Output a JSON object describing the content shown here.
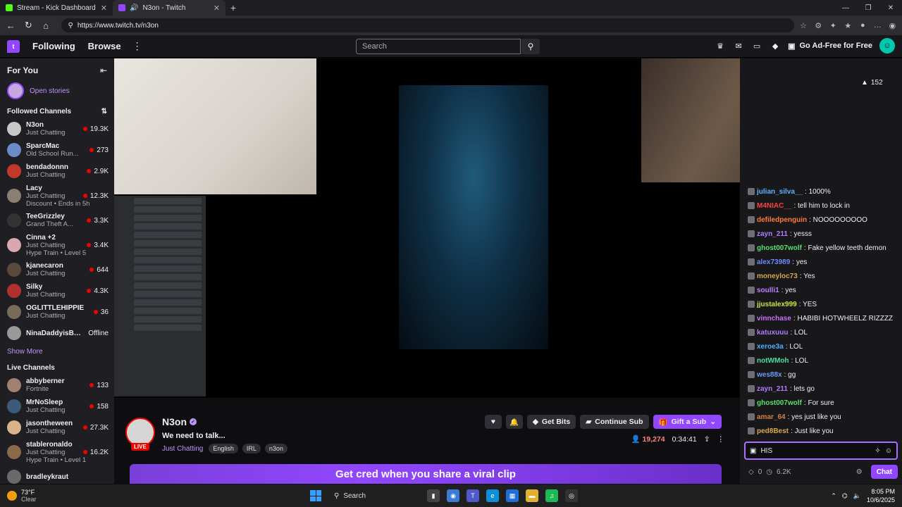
{
  "browser": {
    "tabs": [
      {
        "title": "Stream - Kick Dashboard",
        "active": false,
        "color": "#53fc18"
      },
      {
        "title": "N3on - Twitch",
        "active": true,
        "color": "#9147ff"
      }
    ],
    "url": "https://www.twitch.tv/n3on"
  },
  "topnav": {
    "following": "Following",
    "browse": "Browse",
    "search_placeholder": "Search",
    "ad_free": "Go Ad-Free for Free"
  },
  "sidebar": {
    "for_you": "For You",
    "open_stories": "Open stories",
    "followed_title": "Followed Channels",
    "followed": [
      {
        "name": "N3on",
        "game": "Just Chatting",
        "viewers": "19.3K",
        "extra": "",
        "color": "#c7c7c7"
      },
      {
        "name": "SparcMac",
        "game": "Old School Run...",
        "viewers": "273",
        "extra": "",
        "color": "#6b8cc7"
      },
      {
        "name": "bendadonnn",
        "game": "Just Chatting",
        "viewers": "2.9K",
        "extra": "",
        "color": "#c0392b"
      },
      {
        "name": "Lacy",
        "game": "Just Chatting",
        "viewers": "12.3K",
        "extra": "Discount • Ends in 5h",
        "color": "#8a7f72"
      },
      {
        "name": "TeeGrizzley",
        "game": "Grand Theft A...",
        "viewers": "3.3K",
        "extra": "",
        "color": "#333333"
      },
      {
        "name": "Cinna +2",
        "game": "Just Chatting",
        "viewers": "3.4K",
        "extra": "Hype Train • Level 5",
        "color": "#d9a7b0"
      },
      {
        "name": "kjanecaron",
        "game": "Just Chatting",
        "viewers": "644",
        "extra": "",
        "color": "#5a4a3a"
      },
      {
        "name": "Silky",
        "game": "Just Chatting",
        "viewers": "4.3K",
        "extra": "",
        "color": "#b03030"
      },
      {
        "name": "OGLITTLEHIPPIE",
        "game": "Just Chatting",
        "viewers": "36",
        "extra": "",
        "color": "#7a6a5a"
      },
      {
        "name": "NinaDaddyisBa...",
        "game": "",
        "viewers": "Offline",
        "extra": "",
        "color": "#999999"
      }
    ],
    "show_more": "Show More",
    "live_title": "Live Channels",
    "live": [
      {
        "name": "abbyberner",
        "game": "Fortnite",
        "viewers": "133",
        "extra": "",
        "color": "#a08070"
      },
      {
        "name": "MrNoSleep",
        "game": "Just Chatting",
        "viewers": "158",
        "extra": "",
        "color": "#3c5a7a"
      },
      {
        "name": "jasontheween",
        "game": "Just Chatting",
        "viewers": "27.3K",
        "extra": "",
        "color": "#d8b48a"
      },
      {
        "name": "stableronaldo",
        "game": "Just Chatting",
        "viewers": "16.2K",
        "extra": "Hype Train • Level 1",
        "color": "#8a6a4a"
      },
      {
        "name": "bradleykraut",
        "game": "",
        "viewers": "",
        "extra": "",
        "color": "#6a6a6a"
      }
    ]
  },
  "stream": {
    "name": "N3on",
    "live": "LIVE",
    "title": "We need to talk...",
    "category": "Just Chatting",
    "tags": [
      "English",
      "IRL",
      "n3on"
    ],
    "get_bits": "Get Bits",
    "continue_sub": "Continue Sub",
    "gift_sub": "Gift a Sub",
    "viewers": "19,274",
    "uptime": "0:34:41"
  },
  "banner": "Get cred when you share a viral clip",
  "chat": {
    "viewer_count_side": "152",
    "messages": [
      {
        "user": "julian_silva__",
        "text": ": 1000%",
        "color": "#5fb3ff"
      },
      {
        "user": "M4NIAC__",
        "text": ": tell him to lock in",
        "color": "#ff4040"
      },
      {
        "user": "defiledpenguin",
        "text": ": NOOOOOOOOO",
        "color": "#ff7a3a"
      },
      {
        "user": "zayn_211",
        "text": ": yesss",
        "color": "#b47aff"
      },
      {
        "user": "ghost007wolf",
        "text": ": Fake yellow teeth demon",
        "color": "#57e06b"
      },
      {
        "user": "alex73989",
        "text": ": yes",
        "color": "#6a8cff"
      },
      {
        "user": "moneyloc73",
        "text": ": Yes",
        "color": "#d4a84a"
      },
      {
        "user": "soulli1",
        "text": ": yes",
        "color": "#c080ff"
      },
      {
        "user": "jjustalex999",
        "text": ": YES",
        "color": "#c0e840"
      },
      {
        "user": "vinnchase",
        "text": ": HABIBI HOTWHEELZ RIZZZZ",
        "color": "#c970ff"
      },
      {
        "user": "katuxuuu",
        "text": ": LOL",
        "color": "#b07aff"
      },
      {
        "user": "xeroe3a",
        "text": ": LOL",
        "color": "#4ab0ff"
      },
      {
        "user": "notWMoh",
        "text": ": LOL",
        "color": "#4ae0a0"
      },
      {
        "user": "wes88x",
        "text": ": gg",
        "color": "#6a9aff"
      },
      {
        "user": "zayn_211",
        "text": ": lets go",
        "color": "#b47aff"
      },
      {
        "user": "ghost007wolf",
        "text": ": For sure",
        "color": "#57e06b"
      },
      {
        "user": "amar_64",
        "text": ": yes just like you",
        "color": "#d48040"
      },
      {
        "user": "ped8Best",
        "text": ": Just like you",
        "color": "#d4a84a"
      }
    ],
    "input_value": "HIS",
    "points": "0",
    "bits": "6.2K",
    "chat_button": "Chat"
  },
  "taskbar": {
    "temp": "73°F",
    "weather": "Clear",
    "search": "Search",
    "time": "8:05 PM",
    "date": "10/6/2025"
  }
}
